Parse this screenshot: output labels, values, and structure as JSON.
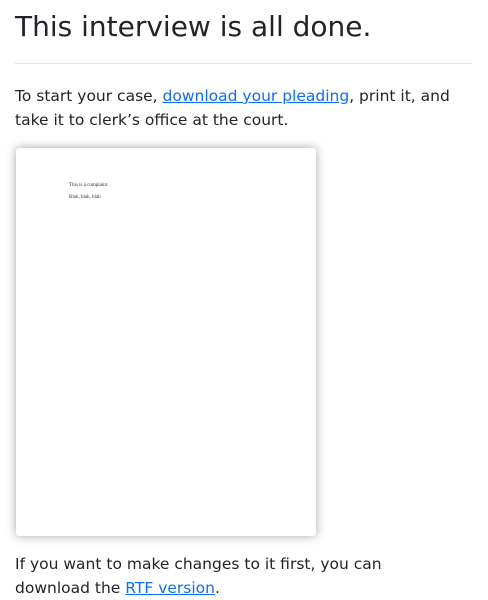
{
  "title": "This interview is all done.",
  "intro": {
    "before": "To start your case, ",
    "link": "download your pleading",
    "after": ", print it, and take it to clerk’s office at the court."
  },
  "preview": {
    "line1": "This is a complaint.",
    "line2": "Blah, blah, blah"
  },
  "outro": {
    "before": "If you want to make changes to it first, you can download the ",
    "link": "RTF version",
    "after": "."
  }
}
